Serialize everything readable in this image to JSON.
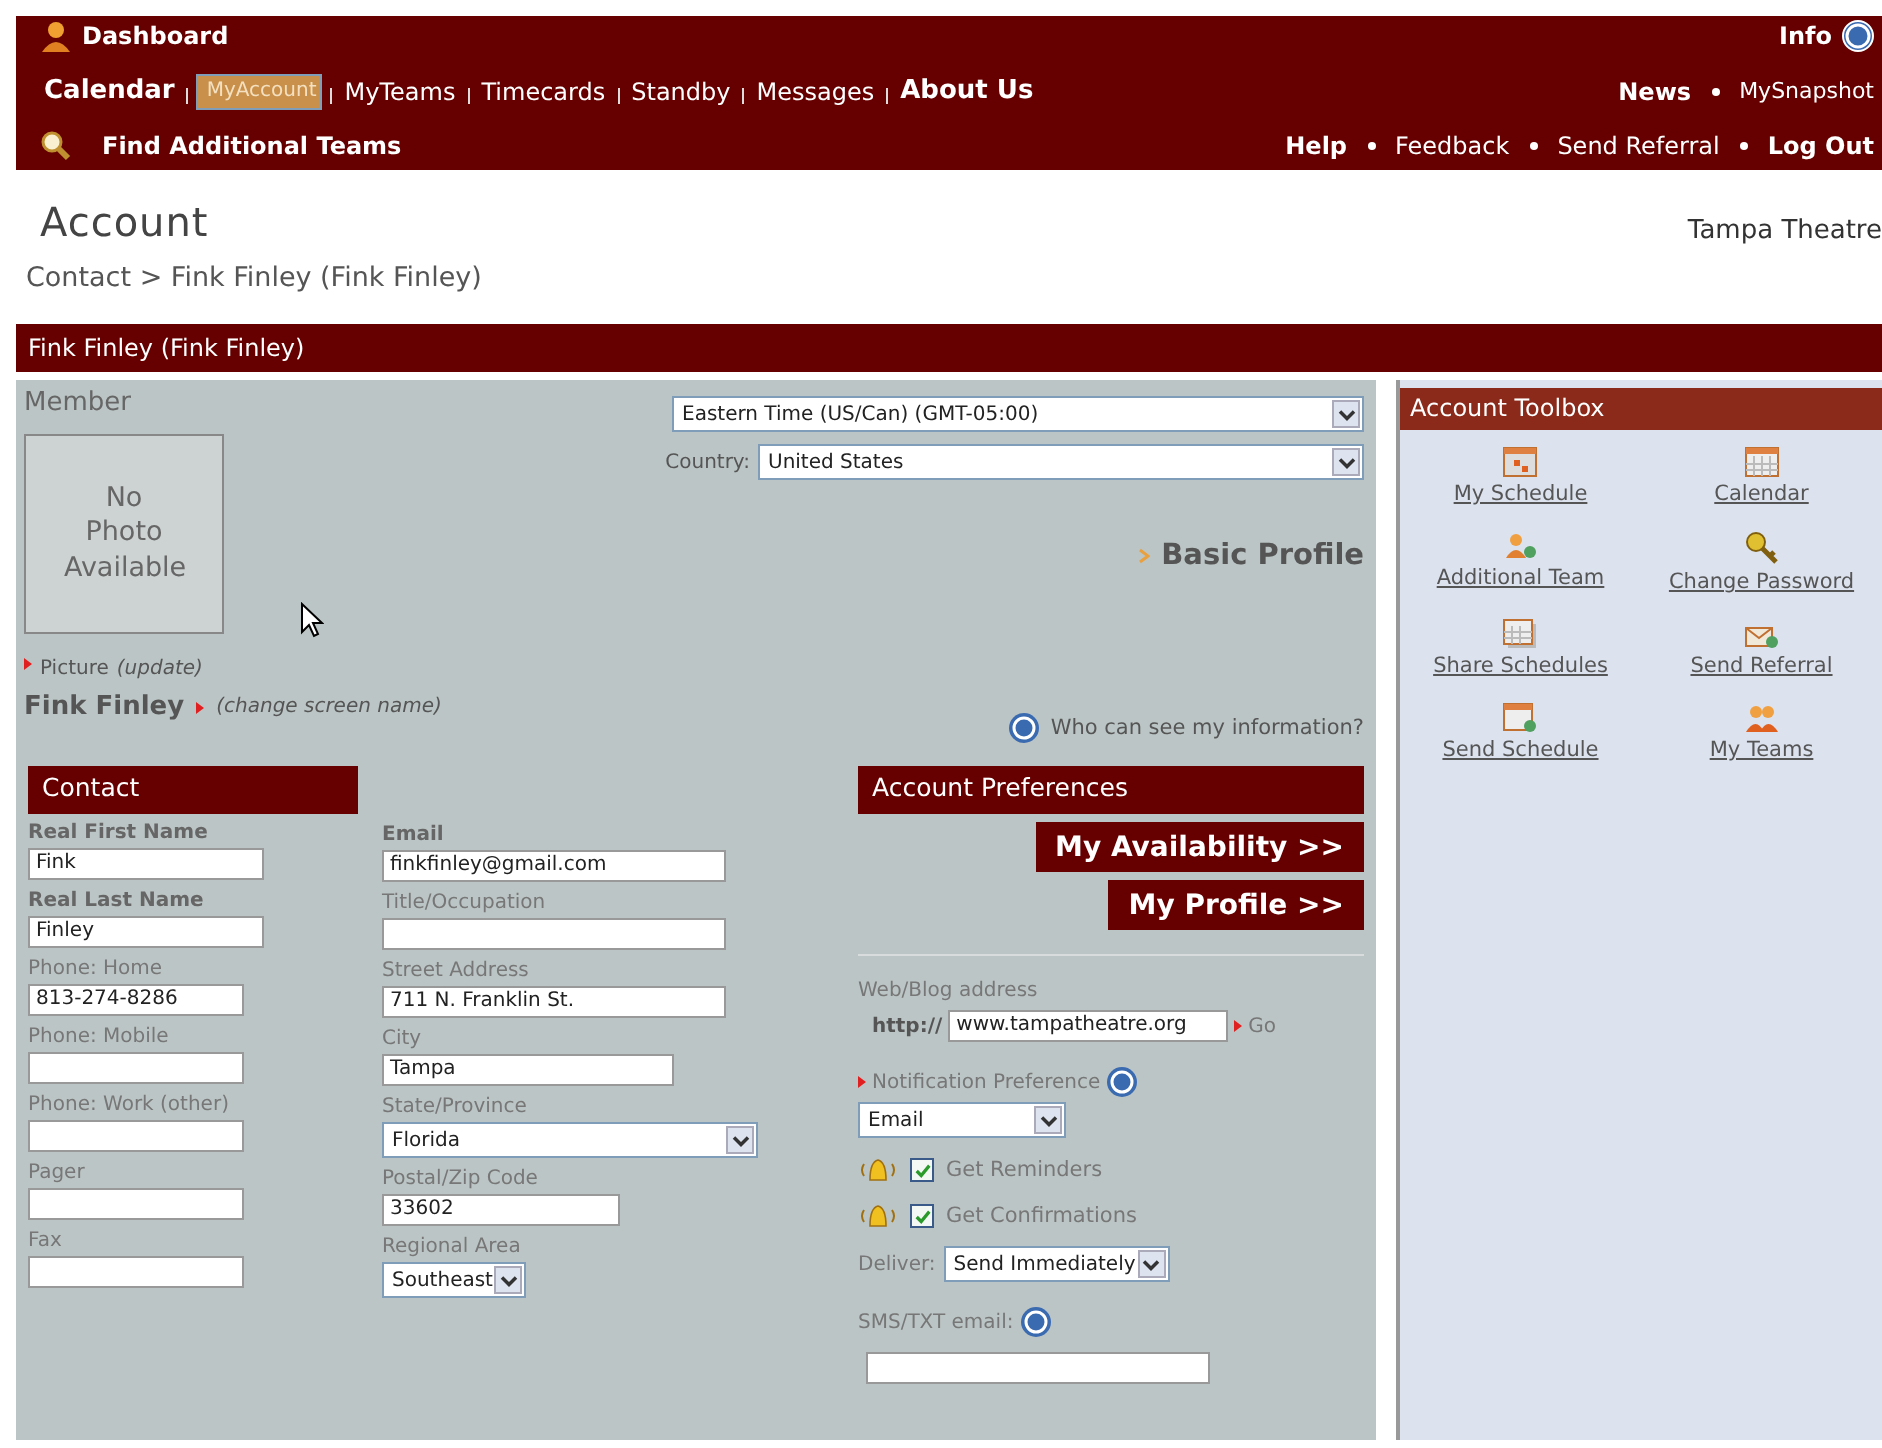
{
  "header": {
    "dashboard": "Dashboard",
    "info": "Info",
    "nav": [
      {
        "label": "Calendar",
        "bold": true,
        "selected": false
      },
      {
        "label": "MyAccount",
        "bold": false,
        "selected": true
      },
      {
        "label": "MyTeams",
        "bold": false,
        "selected": false
      },
      {
        "label": "Timecards",
        "bold": false,
        "selected": false
      },
      {
        "label": "Standby",
        "bold": false,
        "selected": false
      },
      {
        "label": "Messages",
        "bold": false,
        "selected": false
      },
      {
        "label": "About Us",
        "bold": true,
        "selected": false
      }
    ],
    "news": "News",
    "mysnapshot": "MySnapshot",
    "find": "Find Additional Teams",
    "links": [
      {
        "label": "Help",
        "bold": true
      },
      {
        "label": "Feedback",
        "bold": false
      },
      {
        "label": "Send Referral",
        "bold": false
      },
      {
        "label": "Log Out",
        "bold": true
      }
    ]
  },
  "page": {
    "title": "Account",
    "org": "Tampa Theatre",
    "breadcrumb": "Contact > Fink Finley (Fink Finley)"
  },
  "member_bar": "Fink Finley (Fink Finley)",
  "member": {
    "label": "Member",
    "photo": "No Photo Available",
    "picture_label": "Picture",
    "picture_link": "(update)",
    "screen_name": "Fink Finley",
    "change_link": "(change screen name)",
    "timezone": "Eastern Time (US/Can) (GMT-05:00)",
    "country_label": "Country:",
    "country": "United States",
    "basic_profile": "Basic Profile",
    "who_can_see": "Who can see my information?"
  },
  "contact": {
    "title": "Contact",
    "fields": [
      {
        "label": "Real First Name",
        "value": "Fink",
        "bold": true
      },
      {
        "label": "Real Last Name",
        "value": "Finley",
        "bold": true
      },
      {
        "label": "Phone: Home",
        "value": "813-274-8286",
        "bold": false
      },
      {
        "label": "Phone: Mobile",
        "bold": false
      },
      {
        "label": "Phone: Work (other)",
        "bold": false
      },
      {
        "label": "Pager",
        "bold": false
      },
      {
        "label": "Fax",
        "bold": false
      }
    ]
  },
  "address": {
    "fields": [
      {
        "label": "Email",
        "value": "finkfinley@gmail.com",
        "bold": true,
        "kind": "text"
      },
      {
        "label": "Title/Occupation",
        "bold": false,
        "kind": "text"
      },
      {
        "label": "Street Address",
        "value": "711 N. Franklin St.",
        "bold": false,
        "kind": "text"
      },
      {
        "label": "City",
        "value": "Tampa",
        "bold": false,
        "kind": "text"
      },
      {
        "label": "State/Province",
        "value": "Florida",
        "bold": false,
        "kind": "select"
      },
      {
        "label": "Postal/Zip Code",
        "value": "33602",
        "bold": false,
        "kind": "text"
      },
      {
        "label": "Regional Area",
        "value": "Southeast",
        "bold": false,
        "kind": "select"
      }
    ]
  },
  "preferences": {
    "title": "Account Preferences",
    "buttons": [
      "My Availability >>",
      "My Profile >>"
    ],
    "web_label": "Web/Blog address",
    "web_prefix": "http://",
    "web_value": "www.tampatheatre.org",
    "go": "Go",
    "notification_label": "Notification Preference",
    "notification_value": "Email",
    "checkboxes": [
      {
        "label": "Get Reminders",
        "checked": true
      },
      {
        "label": "Get Confirmations",
        "checked": true
      }
    ],
    "deliver_label": "Deliver:",
    "deliver_value": "Send Immediately",
    "sms_label": "SMS/TXT email:"
  },
  "toolbox": {
    "title": "Account Toolbox",
    "items": [
      {
        "label": "My Schedule",
        "kind": "schedule"
      },
      {
        "label": "Calendar",
        "kind": "calendar"
      },
      {
        "label": "Additional Team",
        "kind": "team"
      },
      {
        "label": "Change Password",
        "kind": "key"
      },
      {
        "label": "Share Schedules",
        "kind": "share"
      },
      {
        "label": "Send Referral",
        "kind": "referral"
      },
      {
        "label": "Send Schedule",
        "kind": "send"
      },
      {
        "label": "My Teams",
        "kind": "teams"
      }
    ]
  }
}
